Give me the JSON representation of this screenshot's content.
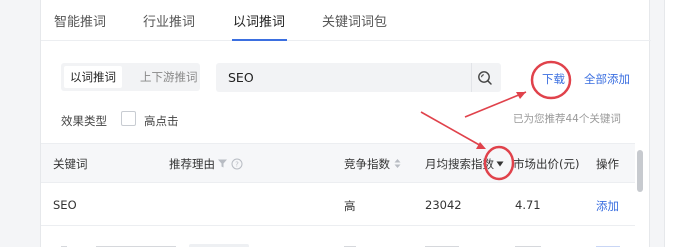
{
  "tabs": [
    {
      "label": "智能推词"
    },
    {
      "label": "行业推词"
    },
    {
      "label": "以词推词"
    },
    {
      "label": "关键词词包"
    }
  ],
  "mode_toggle": {
    "active": "以词推词",
    "inactive": "上下游推词"
  },
  "search": {
    "value": "SEO",
    "icon": "search-icon"
  },
  "actions": {
    "download": "下载",
    "add_all": "全部添加"
  },
  "filter": {
    "label": "效果类型",
    "option": "高点击",
    "checked": false
  },
  "recommend_note": "已为您推荐44个关键词",
  "table": {
    "columns": [
      "关键词",
      "推荐理由",
      "竞争指数",
      "月均搜索指数",
      "市场出价(元)",
      "操作"
    ],
    "rows": [
      {
        "keyword": "SEO",
        "reason": "",
        "competition": "高",
        "monthly_search": "23042",
        "bid": "4.71",
        "action": "添加"
      }
    ]
  },
  "annotation_color": "#e0424b",
  "accent_color": "#3b6fe0"
}
